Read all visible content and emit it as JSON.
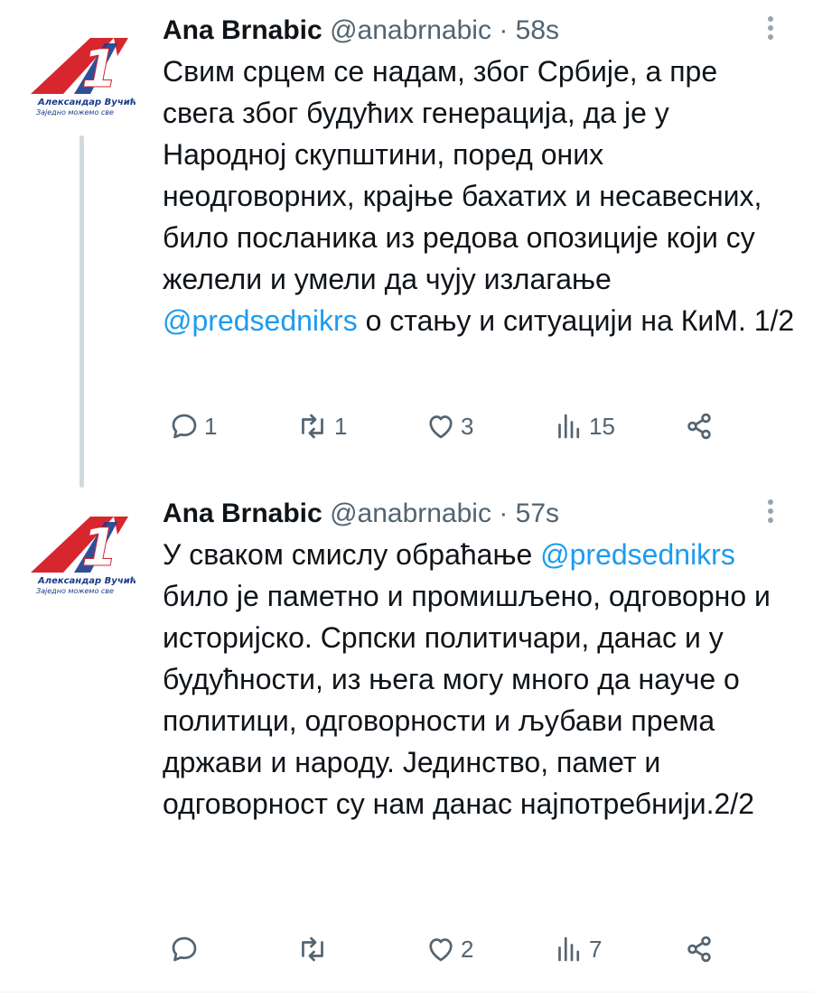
{
  "tweets": [
    {
      "author_name": "Ana Brnabic",
      "handle": "@anabrnabic",
      "separator": "·",
      "time": "58s",
      "text_parts": {
        "before": "Свим срцем се надам, због Србије, а пре свега због будућих генерација, да је у Народној скупштини, поред оних неодговорних, крајње бахатих и несавесних, било посланика из редова опозиције који су желели и умели да чују излагање ",
        "mention": "@predsednikrs",
        "after": " о стању и ситуацији на КиМ. 1/2"
      },
      "avatar": {
        "logo_number": "1",
        "caption_line1": "Александар Вучић",
        "caption_line2": "Заједно можемо све"
      },
      "stats": {
        "replies": "1",
        "retweets": "1",
        "likes": "3",
        "views": "15"
      }
    },
    {
      "author_name": "Ana Brnabic",
      "handle": "@anabrnabic",
      "separator": "·",
      "time": "57s",
      "text_parts": {
        "before": "У сваком смислу обраћање ",
        "mention": "@predsednikrs",
        "after": " било је паметно и промишљено, одговорно и историјско. Српски политичари, данас и у будућности, из њега могу много да науче о политици, одговорности и љубави према држави и народу. Јединство, памет и одговорност су нам данас најпотребнији.2/2"
      },
      "avatar": {
        "logo_number": "1",
        "caption_line1": "Александар Вучић",
        "caption_line2": "Заједно можемо све"
      },
      "stats": {
        "replies": "",
        "retweets": "",
        "likes": "2",
        "views": "7"
      }
    }
  ],
  "icons": {
    "reply": "speech-bubble-icon",
    "retweet": "retweet-arrows-icon",
    "like": "heart-icon",
    "views": "bar-chart-icon",
    "share": "share-nodes-icon",
    "more": "vertical-ellipsis-icon"
  },
  "colors": {
    "text": "#0f1419",
    "secondary": "#536471",
    "mention": "#1d9bf0",
    "logo_red": "#d7262e",
    "logo_blue": "#1b3c8c",
    "thread_line": "#cfd9de"
  }
}
